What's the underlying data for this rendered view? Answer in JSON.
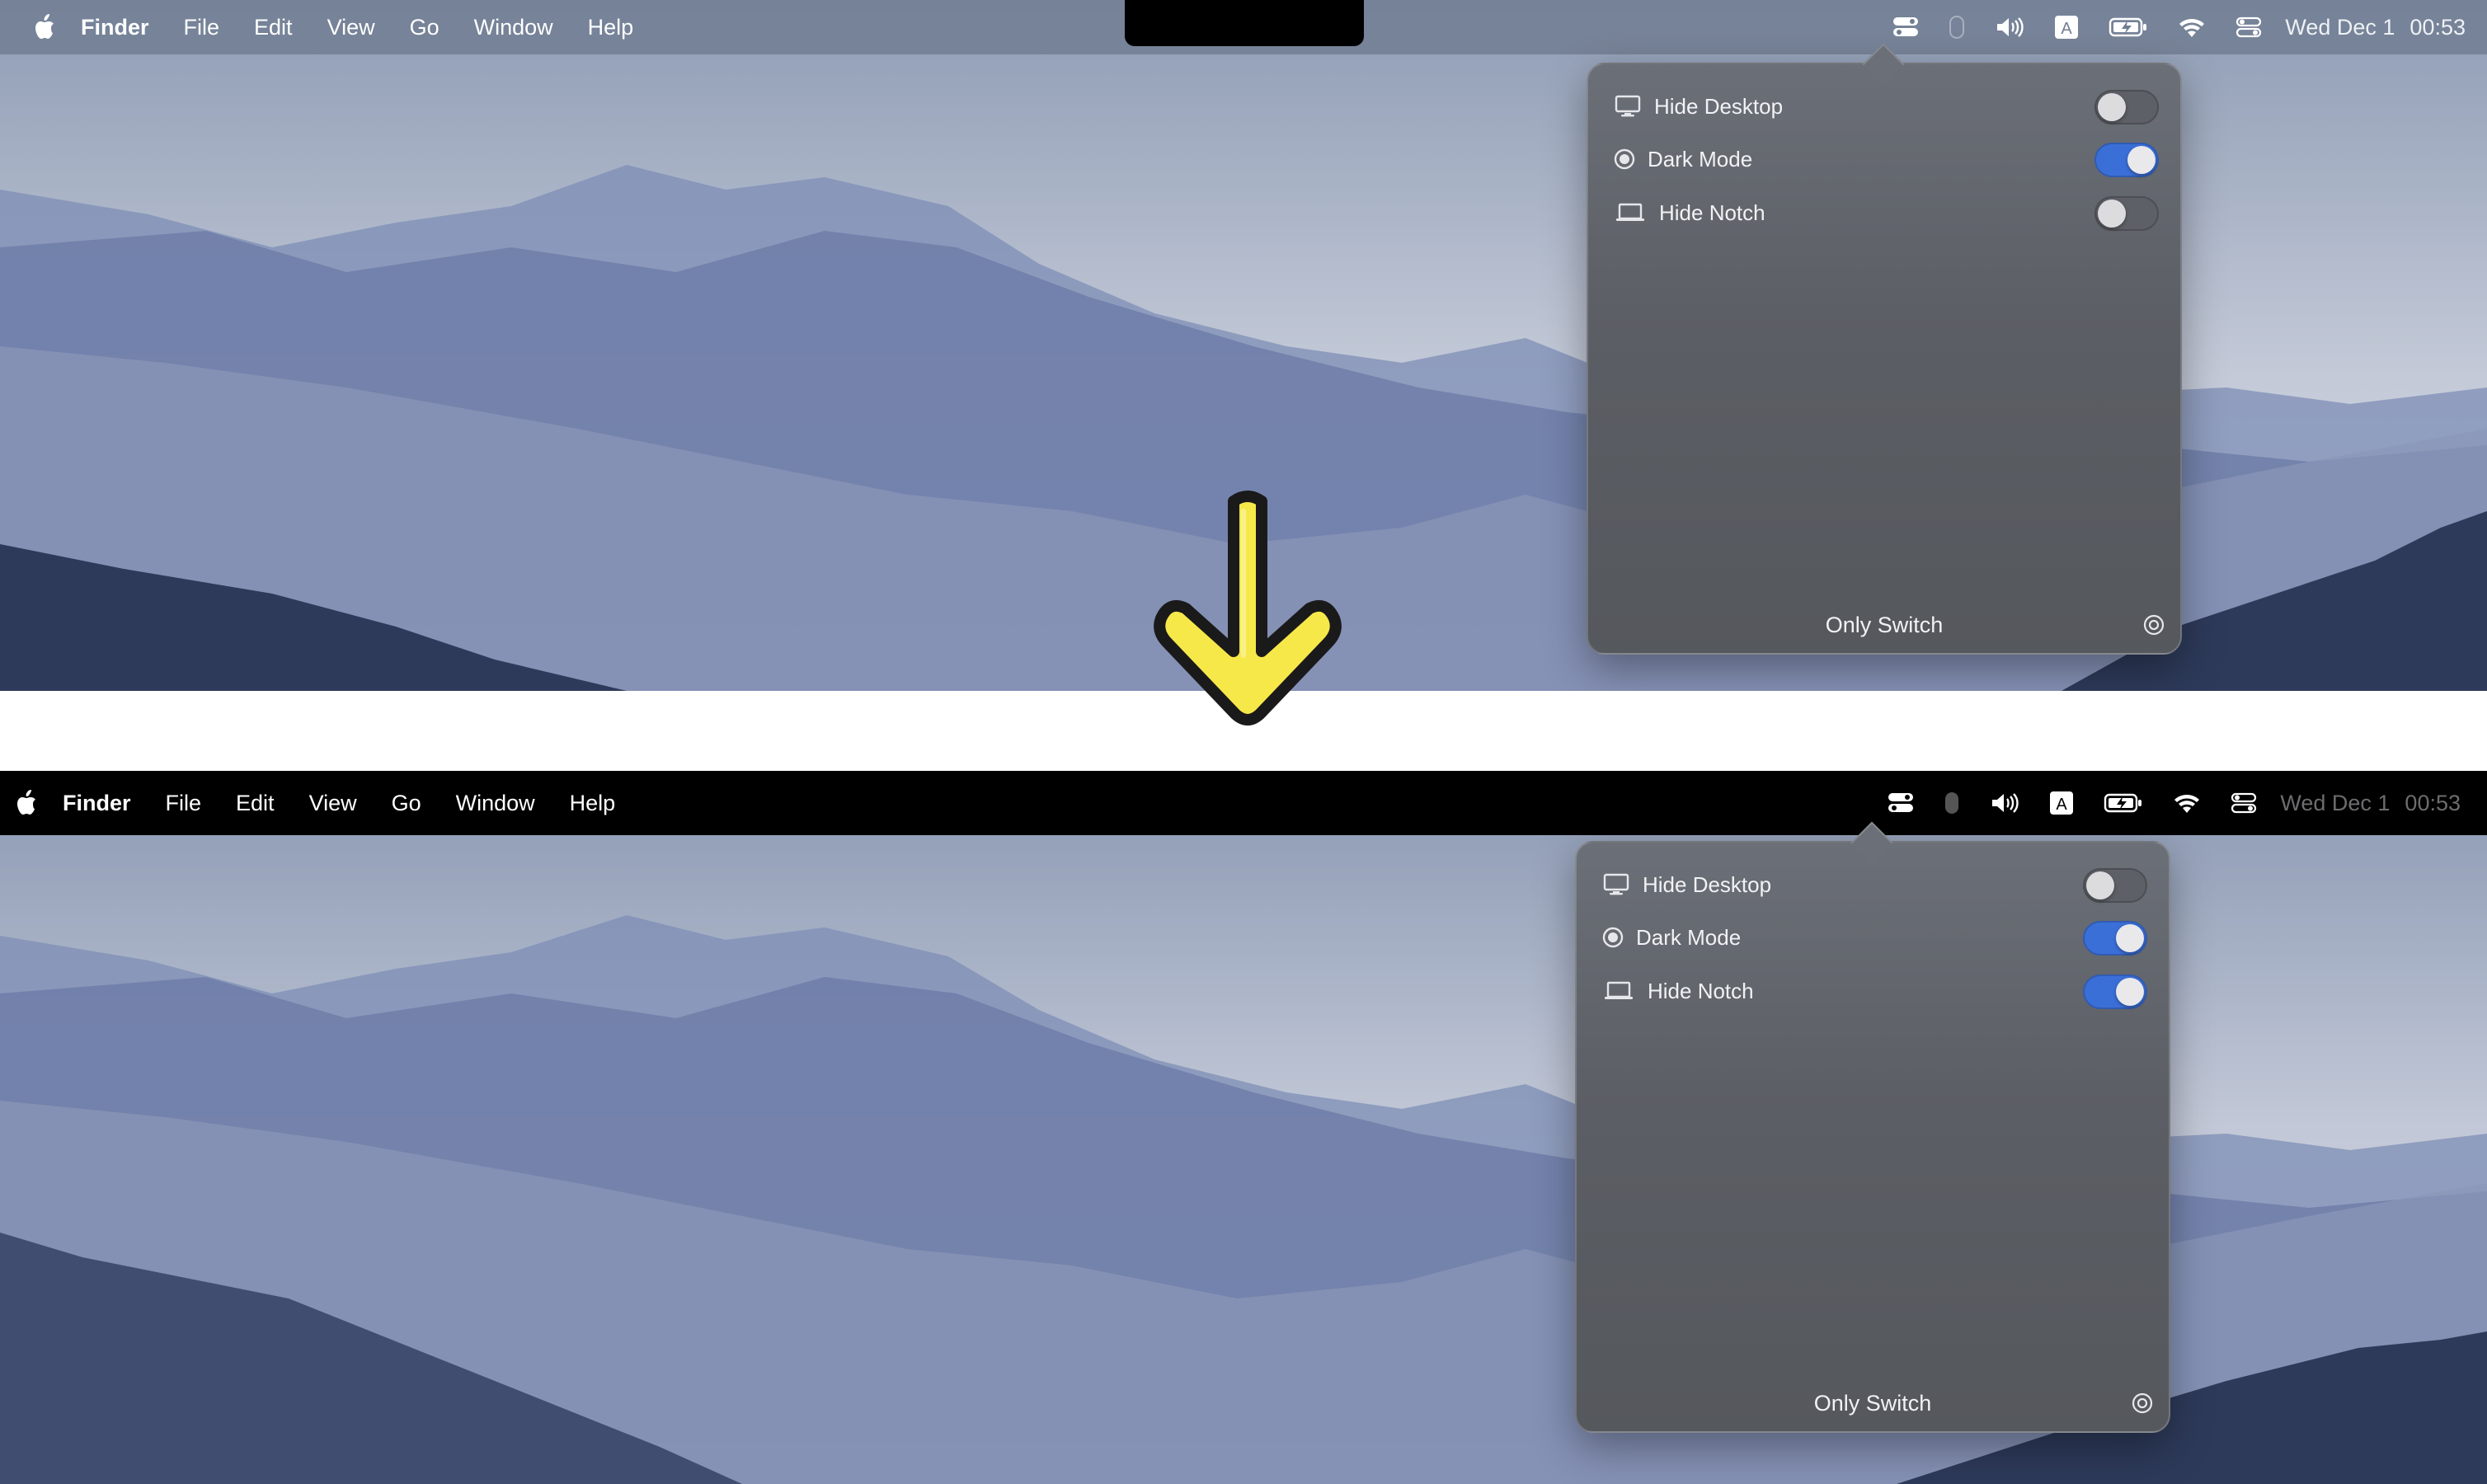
{
  "menubar": {
    "app_name": "Finder",
    "menus": [
      "File",
      "Edit",
      "View",
      "Go",
      "Window",
      "Help"
    ],
    "date": "Wed Dec 1",
    "time": "00:53",
    "input_source": "A"
  },
  "states": [
    {
      "name": "before",
      "menubar_style": "translucent",
      "popover": {
        "items": [
          {
            "label": "Hide Desktop",
            "icon": "display-icon",
            "on": false
          },
          {
            "label": "Dark Mode",
            "icon": "dark-mode-icon",
            "on": true
          },
          {
            "label": "Hide Notch",
            "icon": "laptop-icon",
            "on": false
          }
        ],
        "footer_title": "Only Switch"
      }
    },
    {
      "name": "after",
      "menubar_style": "black",
      "popover": {
        "items": [
          {
            "label": "Hide Desktop",
            "icon": "display-icon",
            "on": false
          },
          {
            "label": "Dark Mode",
            "icon": "dark-mode-icon",
            "on": true
          },
          {
            "label": "Hide Notch",
            "icon": "laptop-icon",
            "on": true
          }
        ],
        "footer_title": "Only Switch"
      }
    }
  ],
  "colors": {
    "toggle_on": "#3b6fd8",
    "arrow": "#f7e84a"
  }
}
